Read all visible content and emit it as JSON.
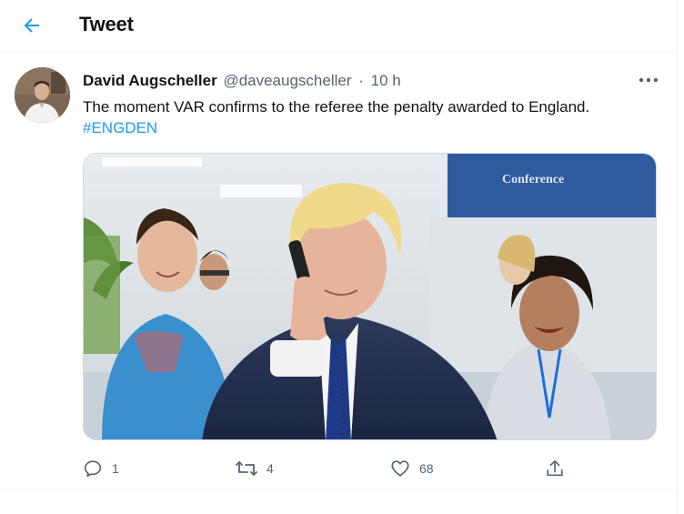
{
  "header": {
    "title": "Tweet",
    "back_icon": "arrow-left-icon",
    "accent": "#1d9bf0"
  },
  "tweet": {
    "author_name": "David Augscheller",
    "author_handle": "@daveaugscheller",
    "separator": "·",
    "time": "10 h",
    "text": "The moment VAR confirms to the referee the penalty awarded to England.",
    "hashtag": "#ENGDEN",
    "more_icon": "more-horizontal-icon",
    "media": {
      "sign_text": "Conference"
    },
    "actions": {
      "reply": {
        "icon": "reply-icon",
        "count": "1"
      },
      "retweet": {
        "icon": "retweet-icon",
        "count": "4"
      },
      "like": {
        "icon": "heart-icon",
        "count": "68"
      },
      "share": {
        "icon": "share-icon"
      }
    }
  },
  "colors": {
    "text_primary": "#0f1419",
    "text_secondary": "#536471",
    "link": "#1d9bf0",
    "divider": "#eff3f4"
  }
}
